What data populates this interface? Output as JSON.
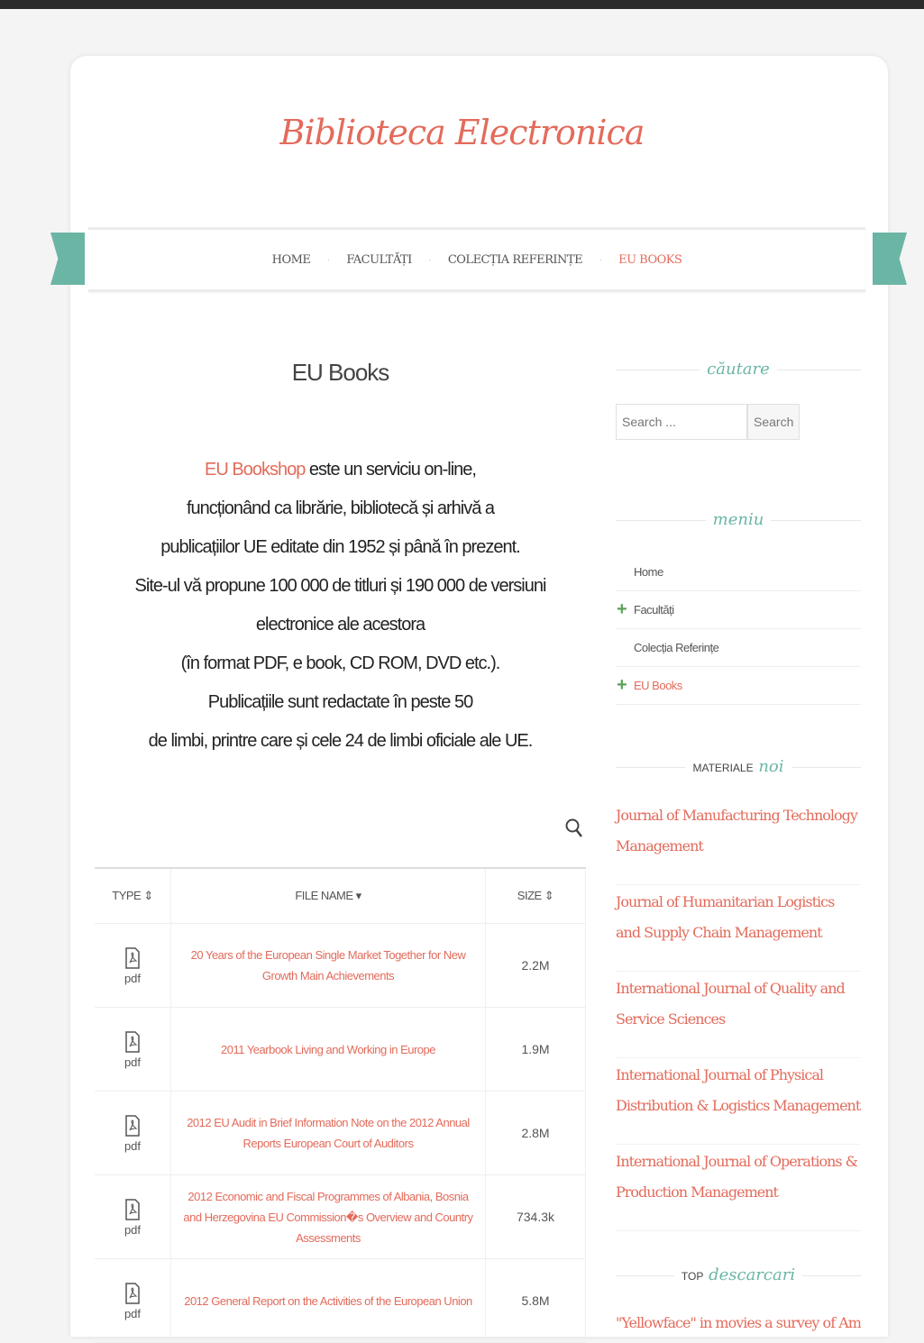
{
  "site": {
    "title": "Biblioteca Electronica"
  },
  "nav": {
    "items": [
      {
        "label": "HOME"
      },
      {
        "label": "FACULTĂȚI"
      },
      {
        "label": "COLECȚIA REFERINȚE"
      },
      {
        "label": "EU BOOKS",
        "active": true
      }
    ],
    "separator": "·"
  },
  "page": {
    "title": "EU Books"
  },
  "intro": {
    "link": "EU Bookshop",
    "line1": " este un serviciu on-line,",
    "lines": [
      "funcționând ca librărie, bibliotecă și arhivă a",
      "publicațiilor UE editate din 1952 și până în prezent.",
      "Site-ul vă propune 100 000 de titluri și 190 000 de versiuni",
      "electronice ale acestora",
      "(în format PDF, e book, CD ROM, DVD etc.).",
      "Publicațiile sunt redactate în peste 50",
      "de limbi, printre care și cele 24 de limbi oficiale ale UE."
    ]
  },
  "table": {
    "headers": {
      "type": "TYPE ⇕",
      "name": "FILE NAME ▾",
      "size": "SIZE ⇕"
    },
    "rows": [
      {
        "type": "pdf",
        "name": "20 Years of the European Single Market Together for New Growth Main Achievements",
        "size": "2.2M"
      },
      {
        "type": "pdf",
        "name": "2011 Yearbook Living and Working in Europe",
        "size": "1.9M"
      },
      {
        "type": "pdf",
        "name": "2012 EU Audit in Brief Information Note on the 2012 Annual Reports European Court of Auditors",
        "size": "2.8M"
      },
      {
        "type": "pdf",
        "name": "2012 Economic and Fiscal Programmes of Albania, Bosnia and Herzegovina EU Commission�s Overview and Country Assessments",
        "size": "734.3k"
      },
      {
        "type": "pdf",
        "name": "2012 General Report on the Activities of the European Union",
        "size": "5.8M"
      }
    ]
  },
  "sidebar": {
    "search": {
      "heading": "căutare",
      "placeholder": "Search ...",
      "button": "Search"
    },
    "menu": {
      "heading": "meniu",
      "items": [
        {
          "label": "Home"
        },
        {
          "label": "Facultăți",
          "expandable": true
        },
        {
          "label": "Colecția Referințe"
        },
        {
          "label": "EU Books",
          "expandable": true,
          "active": true
        }
      ]
    },
    "new_materials": {
      "heading_small": "MATERIALE",
      "heading": "noi",
      "items": [
        "Journal of Manufacturing Technology Management",
        "Journal of Humanitarian Logistics and Supply Chain Management",
        "International Journal of Quality and Service Sciences",
        "International Journal of Physical Distribution & Logistics Management",
        "International Journal of Operations & Production Management"
      ]
    },
    "top_downloads": {
      "heading_small": "TOP",
      "heading": "descarcari",
      "item": "\"Yellowface\" in movies a survey of American"
    }
  },
  "colors": {
    "accent": "#e36b5b",
    "teal": "#6bb5a5",
    "green": "#5aa15a"
  },
  "icons": {
    "table_search": "search-icon",
    "file": "pdf-file-icon",
    "expand": "plus-icon"
  }
}
